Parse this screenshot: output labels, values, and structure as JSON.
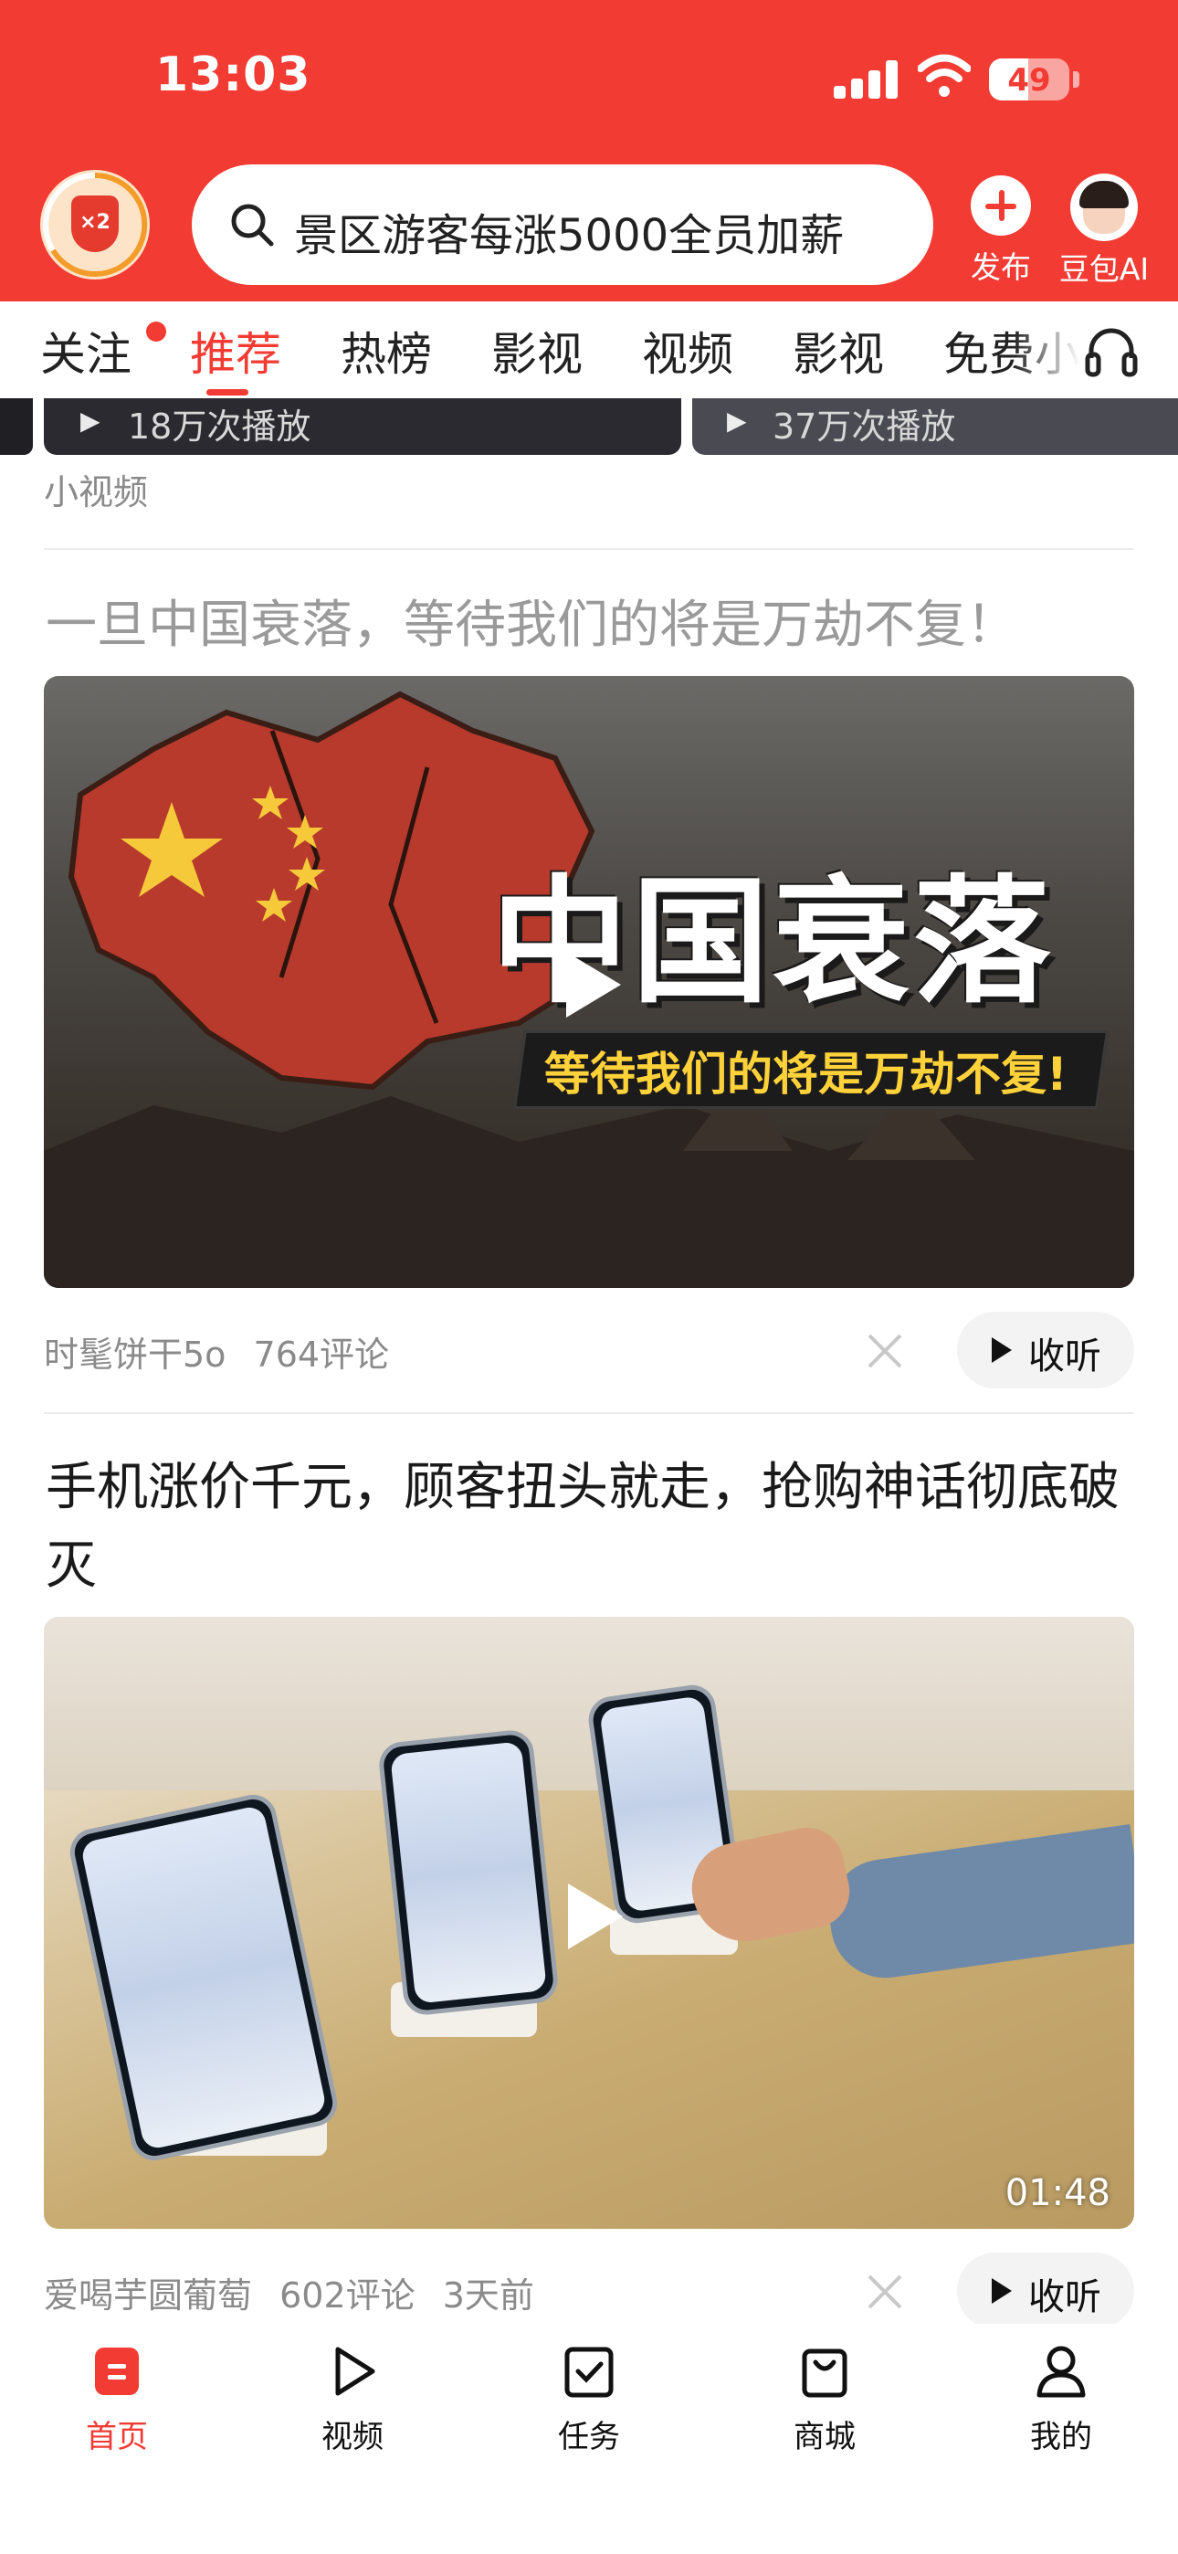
{
  "status_bar": {
    "time": "13:03",
    "battery": "49",
    "battery_level": 0.49
  },
  "header": {
    "badge_text": "×2",
    "search_text": "景区游客每涨5000全员加薪",
    "publish_label": "发布",
    "doubao_label": "豆包AI"
  },
  "tabs": [
    "关注",
    "推荐",
    "热榜",
    "影视",
    "视频",
    "影视",
    "免费小"
  ],
  "active_tab": "推荐",
  "feed": {
    "clips": [
      {
        "views": "18万次播放"
      },
      {
        "views": "37万次播放"
      }
    ],
    "section_label": "小视频",
    "articles": [
      {
        "title": "一旦中国衰落，等待我们的将是万劫不复！",
        "thumb_title": "中国衰落",
        "thumb_banner": "等待我们的将是万劫不复!",
        "author": "时髦饼干5o",
        "comments": "764评论",
        "listen_label": "收听"
      },
      {
        "title": "手机涨价千元，顾客扭头就走，抢购神话彻底破灭",
        "duration": "01:48",
        "author": "爱喝芋圆葡萄",
        "comments": "602评论",
        "time_ago": "3天前",
        "listen_label": "收听"
      }
    ]
  },
  "bottom_nav": [
    {
      "label": "首页",
      "icon": "home-icon",
      "active": true
    },
    {
      "label": "视频",
      "icon": "video-play-icon",
      "active": false
    },
    {
      "label": "任务",
      "icon": "task-check-icon",
      "active": false
    },
    {
      "label": "商城",
      "icon": "shop-bag-icon",
      "active": false
    },
    {
      "label": "我的",
      "icon": "profile-icon",
      "active": false
    }
  ],
  "colors": {
    "brand_red": "#f23b33",
    "read_title": "#9a9a9a",
    "meta_gray": "#8a8a8a"
  }
}
